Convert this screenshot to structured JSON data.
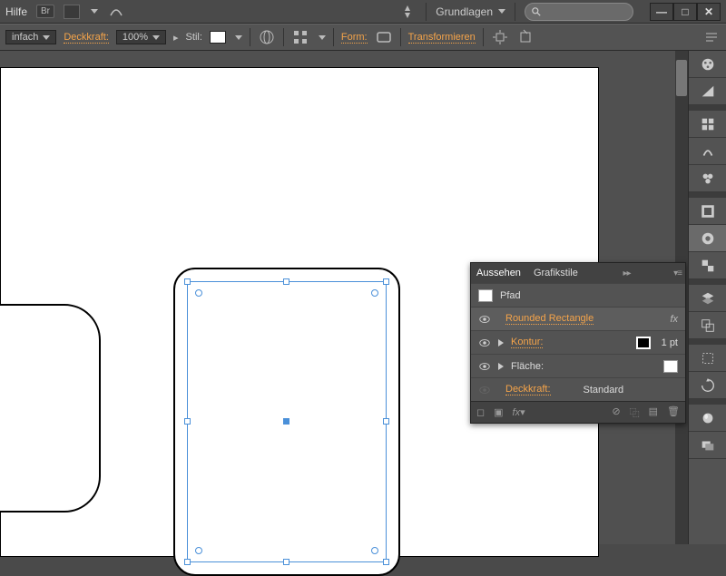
{
  "menubar": {
    "help": "Hilfe",
    "br": "Br",
    "workspace": "Grundlagen"
  },
  "windowControls": {
    "min": "—",
    "max": "□",
    "close": "✕"
  },
  "options": {
    "style_label": "infach",
    "opacity_label": "Deckkraft:",
    "opacity_value": "100%",
    "stil_label": "Stil:",
    "form_label": "Form:",
    "transform_label": "Transformieren"
  },
  "panel": {
    "tab_appearance": "Aussehen",
    "tab_styles": "Grafikstile",
    "path": "Pfad",
    "effect": "Rounded Rectangle",
    "fx": "fx",
    "stroke_label": "Kontur:",
    "stroke_val": "1 pt",
    "fill_label": "Fläche:",
    "opacity_label": "Deckkraft:",
    "opacity_val": "Standard"
  },
  "icons": {
    "palette": "palette",
    "triangle": "triangle",
    "grid": "grid",
    "brush": "brush",
    "clover": "clover",
    "swatch": "swatch",
    "circle": "circle",
    "layers": "layers",
    "shapes": "shapes",
    "copy": "copy",
    "artboard": "artboard",
    "rotate": "rotate",
    "sphere": "sphere",
    "stack": "stack"
  }
}
